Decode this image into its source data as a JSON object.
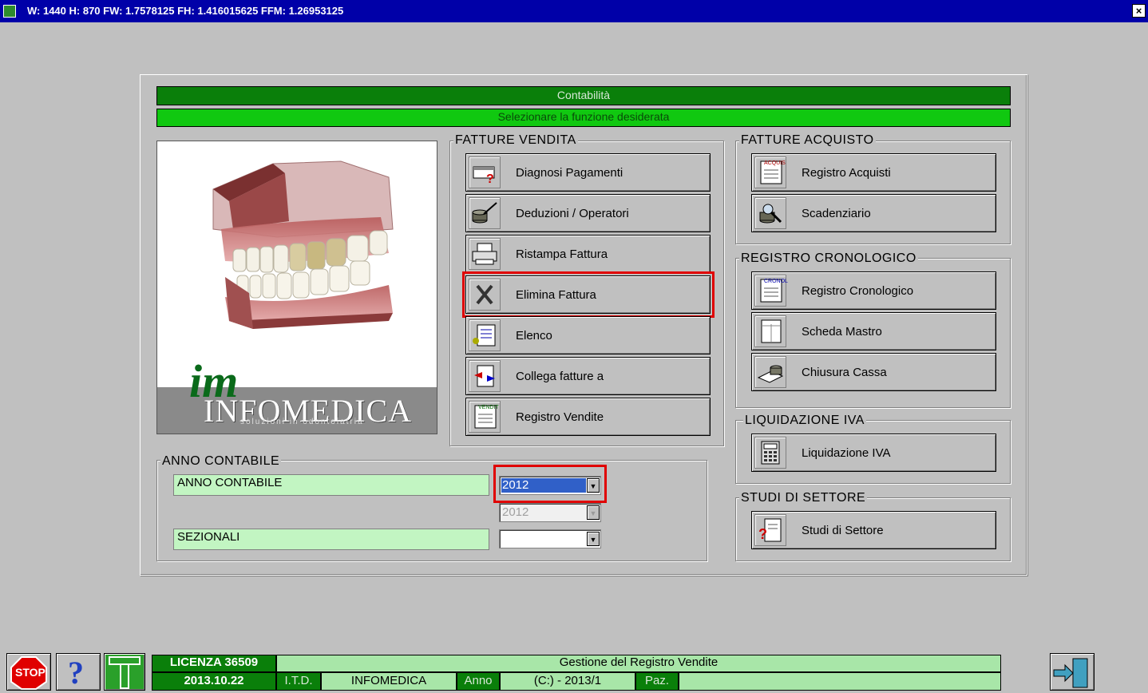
{
  "window": {
    "title": "W: 1440 H: 870 FW: 1.7578125 FH: 1.416015625 FFM:  1.26953125",
    "close": "×"
  },
  "header": {
    "title": "Contabilità",
    "subtitle": "Selezionare la funzione desiderata"
  },
  "logo": {
    "brand": "INFOMEDICA",
    "tagline": "soluzioni in odontoiatria",
    "monogram": "im"
  },
  "vendita": {
    "title": "FATTURE VENDITA",
    "buttons": [
      {
        "label": "Diagnosi Pagamenti",
        "icon": "invoice-question-icon"
      },
      {
        "label": "Deduzioni / Operatori",
        "icon": "coins-syringe-icon"
      },
      {
        "label": "Ristampa Fattura",
        "icon": "printer-icon"
      },
      {
        "label": "Elimina Fattura",
        "icon": "scissors-icon"
      },
      {
        "label": "Elenco",
        "icon": "list-icon"
      },
      {
        "label": "Collega fatture a",
        "icon": "link-invoice-icon"
      },
      {
        "label": "Registro Vendite",
        "icon": "sales-register-icon",
        "badge": "VENDIT"
      }
    ]
  },
  "acquisto": {
    "title": "FATTURE ACQUISTO",
    "buttons": [
      {
        "label": "Registro Acquisti",
        "icon": "purchase-register-icon",
        "badge": "ACQUIS"
      },
      {
        "label": "Scadenziario",
        "icon": "coins-search-icon"
      }
    ]
  },
  "cronologico": {
    "title": "REGISTRO CRONOLOGICO",
    "buttons": [
      {
        "label": "Registro Cronologico",
        "icon": "chronological-register-icon",
        "badge": "CRONOL"
      },
      {
        "label": "Scheda Mastro",
        "icon": "ledger-card-icon"
      },
      {
        "label": "Chiusura Cassa",
        "icon": "cash-close-icon"
      }
    ]
  },
  "iva": {
    "title": "LIQUIDAZIONE IVA",
    "buttons": [
      {
        "label": "Liquidazione IVA",
        "icon": "calculator-icon"
      }
    ]
  },
  "studi": {
    "title": "STUDI DI SETTORE",
    "buttons": [
      {
        "label": "Studi di Settore",
        "icon": "document-question-icon"
      }
    ]
  },
  "anno": {
    "group_title": "ANNO CONTABILE",
    "anno_label": "ANNO CONTABILE",
    "anno_value": "2012",
    "anno_value_disabled": "2012",
    "sezionali_label": "SEZIONALI",
    "sezionali_value": ""
  },
  "status": {
    "licenza": "LICENZA 36509",
    "date": "2013.10.22",
    "description": "Gestione del Registro Vendite",
    "itd": "I.T.D.",
    "company": "INFOMEDICA",
    "anno_label": "Anno",
    "drive": "(C:) - 2013/1",
    "paz_label": "Paz.",
    "stop": "STOP",
    "help": "?"
  },
  "colors": {
    "highlight": "#e00000",
    "dark_green": "#0a7f0a",
    "light_green": "#10c810",
    "title_blue": "#0000a8"
  }
}
